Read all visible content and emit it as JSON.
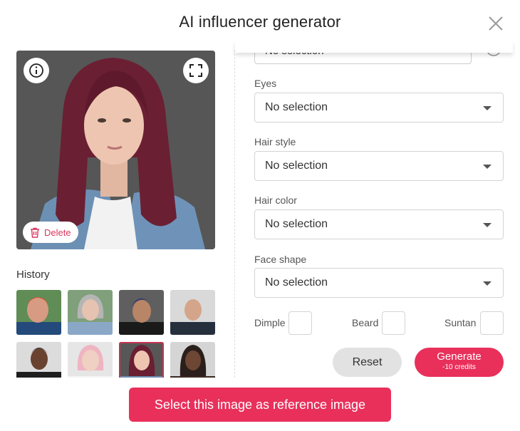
{
  "dialog": {
    "title": "AI influencer generator"
  },
  "preview": {
    "delete_label": "Delete"
  },
  "history": {
    "label": "History",
    "selected_index": 6,
    "count": 8
  },
  "form": {
    "partial_select_value": "No selection",
    "fields": [
      {
        "label": "Eyes",
        "value": "No selection"
      },
      {
        "label": "Hair style",
        "value": "No selection"
      },
      {
        "label": "Hair color",
        "value": "No selection"
      },
      {
        "label": "Face shape",
        "value": "No selection"
      }
    ],
    "checkboxes": [
      {
        "label": "Dimple",
        "checked": false
      },
      {
        "label": "Beard",
        "checked": false
      },
      {
        "label": "Suntan",
        "checked": false
      }
    ]
  },
  "actions": {
    "reset_label": "Reset",
    "generate_label": "Generate",
    "generate_cost": "-10 credits",
    "select_reference_label": "Select this image as reference image"
  },
  "colors": {
    "accent": "#e8305b",
    "delete_text": "#d9365e",
    "reset_bg": "#e2e2e2"
  }
}
